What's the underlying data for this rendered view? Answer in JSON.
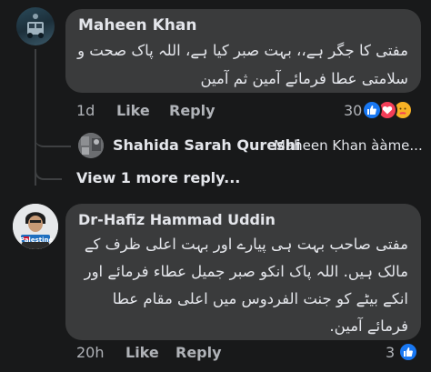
{
  "comments": [
    {
      "author": "Maheen Khan",
      "text": "مفتی کا جگر ہے،، بہت صبر کیا ہے، اللہ پاک صحت و\nسلامتی عطا فرمائے آمین ثم آمین",
      "time": "1d",
      "like_label": "Like",
      "reply_label": "Reply",
      "reaction_count": "30",
      "reactions": [
        "like-reaction-icon",
        "love-reaction-icon",
        "care-reaction-icon"
      ]
    },
    {
      "author": "Dr-Hafiz Hammad Uddin",
      "avatar_badge": "Palestine",
      "text": "مفتی صاحب بہت ہی پیارے اور بہت اعلی ظرف کے\nمالک ہیں. اللہ پاک انکو صبر جمیل عطاء فرمائے اور\nانکے بیٹے کو جنت الفردوس میں اعلی مقام عطا\nفرمائے آمین.",
      "time": "20h",
      "like_label": "Like",
      "reply_label": "Reply",
      "reaction_count": "3"
    }
  ],
  "reply_preview": {
    "author": "Shahida Sarah Qureshi",
    "text": "Maheen Khan ààme..."
  },
  "view_more": "View 1 more reply..."
}
